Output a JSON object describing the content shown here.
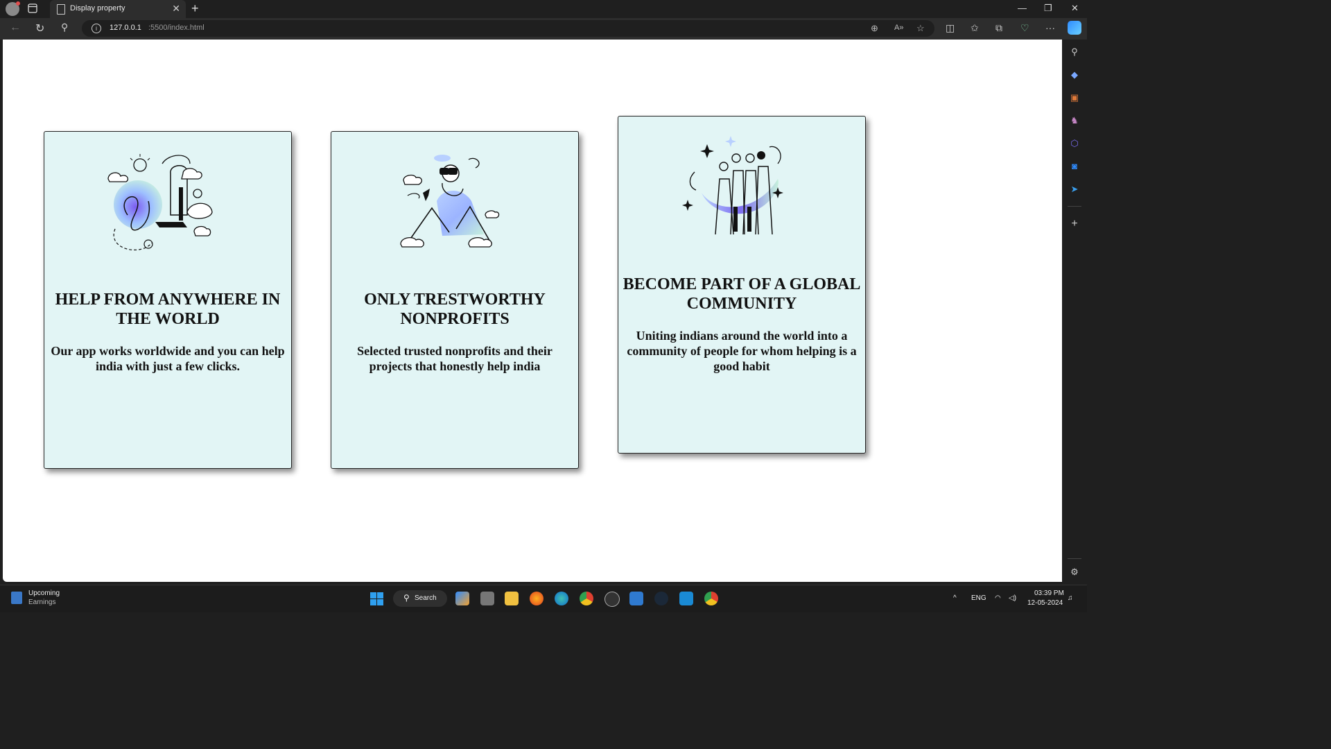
{
  "browser": {
    "tab_title": "Display property",
    "url_host": "127.0.0.1",
    "url_rest": ":5500/index.html"
  },
  "cards": [
    {
      "heading": "HELP FROM ANYWHERE IN THE WORLD",
      "description": "Our app works worldwide and you can help india with just a few clicks.",
      "illustration": "person-with-laptop-and-globe-illustration"
    },
    {
      "heading": "ONLY TRESTWORTHY NONPROFITS",
      "description": "Selected trusted nonprofits and their projects that honestly help india",
      "illustration": "person-with-binoculars-on-mountain-illustration"
    },
    {
      "heading": "BECOME PART OF A GLOBAL COMMUNITY",
      "description": "Uniting indians around the world into a community of people for whom helping is a good habit",
      "illustration": "group-of-people-community-illustration"
    }
  ],
  "taskbar": {
    "widget_line1": "Upcoming",
    "widget_line2": "Earnings",
    "search_label": "Search",
    "language": "ENG",
    "time": "03:39 PM",
    "date": "12-05-2024"
  },
  "colors": {
    "card_background": "#e2f5f5",
    "page_background": "#ffffff",
    "browser_chrome": "#1f1f1f"
  }
}
